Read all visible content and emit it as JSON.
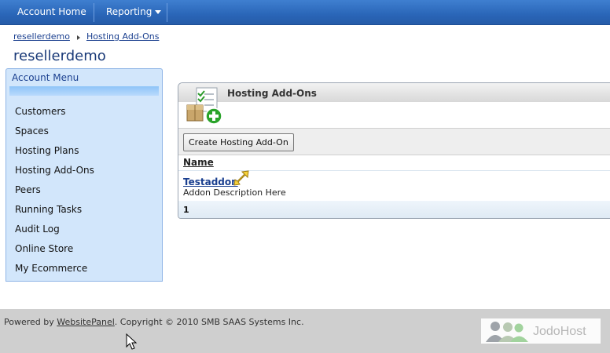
{
  "nav": {
    "account_home": "Account Home",
    "reporting": "Reporting"
  },
  "breadcrumb": {
    "root": "resellerdemo",
    "current": "Hosting Add-Ons"
  },
  "page": {
    "title": "resellerdemo"
  },
  "sidebar": {
    "title": "Account Menu",
    "items": [
      {
        "label": "Customers"
      },
      {
        "label": "Spaces"
      },
      {
        "label": "Hosting Plans"
      },
      {
        "label": "Hosting Add-Ons"
      },
      {
        "label": "Peers"
      },
      {
        "label": "Running Tasks"
      },
      {
        "label": "Audit Log"
      },
      {
        "label": "Online Store"
      },
      {
        "label": "My Ecommerce"
      }
    ]
  },
  "panel": {
    "title": "Hosting Add-Ons",
    "create_button": "Create Hosting Add-On",
    "column_name": "Name",
    "rows": [
      {
        "name": "Testaddon",
        "description": "Addon Description Here"
      }
    ],
    "pager": "1"
  },
  "footer": {
    "powered_by": "Powered by ",
    "link": "WebsitePanel",
    "copyright": ". Copyright © 2010 SMB SAAS Systems Inc.",
    "logo_text": "JodoHost"
  },
  "icons": {
    "panel": "addon-package-icon",
    "pointer": "arrow-pointer-icon"
  }
}
